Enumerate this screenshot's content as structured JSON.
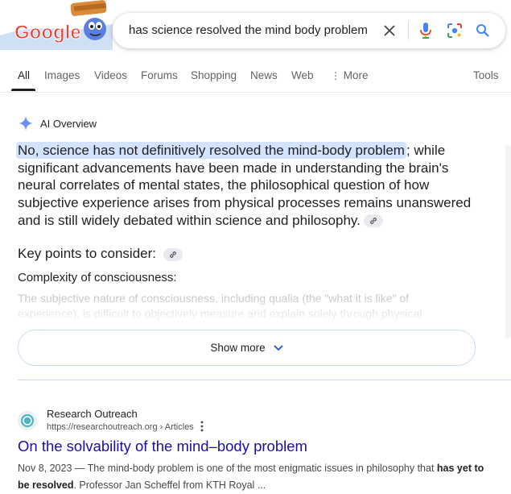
{
  "search": {
    "query": "has science resolved the mind body problem"
  },
  "logo": {
    "text": "Google"
  },
  "tabs": [
    {
      "label": "All",
      "active": true
    },
    {
      "label": "Images"
    },
    {
      "label": "Videos"
    },
    {
      "label": "Forums"
    },
    {
      "label": "Shopping"
    },
    {
      "label": "News"
    },
    {
      "label": "Web"
    },
    {
      "label": "More"
    },
    {
      "label": "Tools"
    }
  ],
  "ai_overview": {
    "title": "AI Overview",
    "highlight": "No, science has not definitively resolved the mind-body problem",
    "body_rest": "; while significant advancements have been made in understanding the brain's neural correlates of mental states, the philosophical question of how subjective experience arises from physical processes remains unanswered and is still widely debated within science and philosophy.",
    "key_points_title": "Key points to consider:",
    "subheading": "Complexity of consciousness:",
    "faded_text": "The subjective nature of consciousness, including qualia (the \"what it is like\" of experience), is difficult to objectively measure and explain solely through physical",
    "show_more": "Show more"
  },
  "result": {
    "site_name": "Research Outreach",
    "url": "https://researchoutreach.org › Articles",
    "title": "On the solvability of the mind–body problem",
    "snippet_date": "Nov 8, 2023",
    "snippet_1": " — The mind-body problem is one of the most enigmatic issues in philosophy that ",
    "snippet_bold": "has yet to be resolved",
    "snippet_2": ". Professor Jan Scheffel from KTH Royal ..."
  },
  "colors": {
    "link": "#1a0dab",
    "highlight": "#d3e3fd",
    "accent_blue": "#4285f4"
  }
}
